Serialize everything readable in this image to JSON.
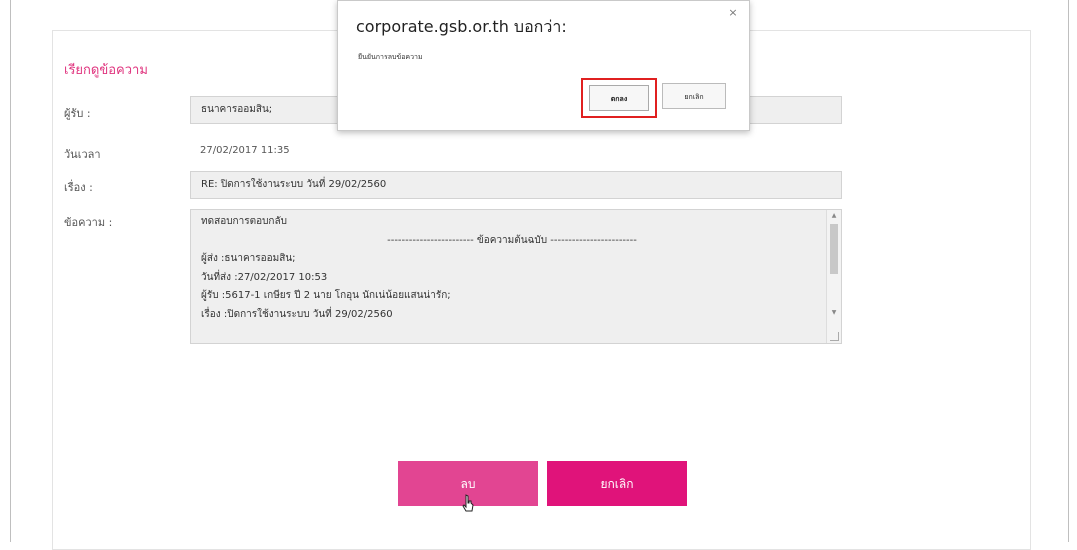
{
  "form": {
    "title": "เรียกดูข้อความ",
    "labels": {
      "recipient": "ผู้รับ :",
      "datetime": "วันเวลา",
      "subject": "เรื่อง :",
      "message": "ข้อความ :"
    },
    "recipient_value": "ธนาคารออมสิน;",
    "datetime_value": "27/02/2017 11:35",
    "subject_value": "RE: ปิดการใช้งานระบบ วันที่ 29/02/2560",
    "message_lines": [
      "ทดสอบการตอบกลับ",
      "------------------------ ข้อความต้นฉบับ ------------------------",
      "ผู้ส่ง :ธนาคารออมสิน;",
      "วันที่ส่ง :27/02/2017 10:53",
      "ผู้รับ :5617-1 เกษียร ปี 2 นาย โกอุน นักเน่น้อยแสนน่ารัก;",
      "เรื่อง :ปิดการใช้งานระบบ วันที่ 29/02/2560"
    ],
    "delete_label": "ลบ",
    "cancel_label": "ยกเลิก"
  },
  "dialog": {
    "title": "corporate.gsb.or.th บอกว่า:",
    "message": "ยืนยันการลบข้อความ",
    "ok_label": "ตกลง",
    "cancel_label": "ยกเลิก",
    "close_glyph": "×"
  },
  "colors": {
    "accent": "#e0357f",
    "field_bg": "#efefef",
    "highlight": "#e02020"
  }
}
